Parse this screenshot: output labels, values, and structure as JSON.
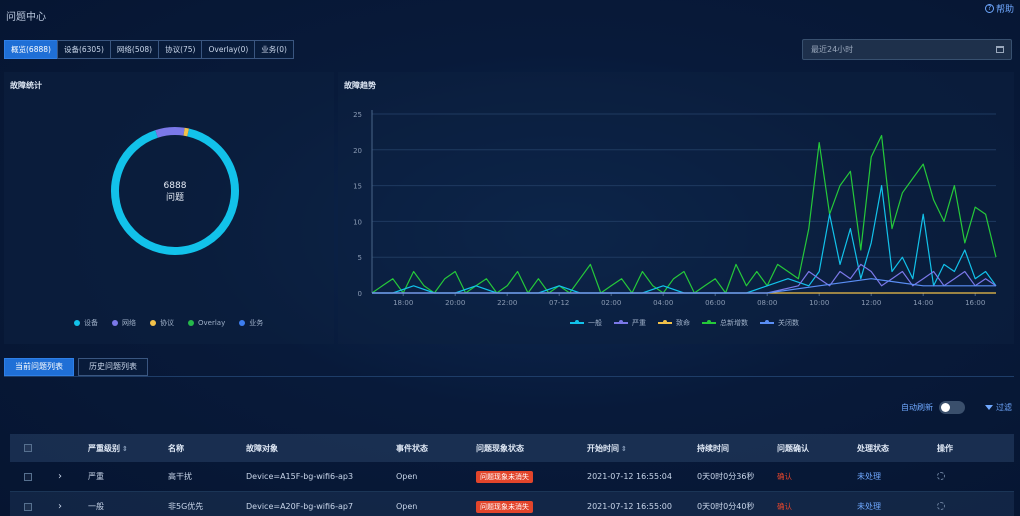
{
  "header": {
    "title": "问题中心",
    "help_label": "帮助",
    "help_icon": "?"
  },
  "tabs": [
    {
      "label": "概览(6888)",
      "active": true
    },
    {
      "label": "设备(6305)",
      "active": false
    },
    {
      "label": "网络(508)",
      "active": false
    },
    {
      "label": "协议(75)",
      "active": false
    },
    {
      "label": "Overlay(0)",
      "active": false
    },
    {
      "label": "业务(0)",
      "active": false
    }
  ],
  "time_range": {
    "value": "最近24小时",
    "icon": "calendar-icon"
  },
  "fault_stats": {
    "title": "故障统计",
    "total": "6888",
    "unit": "问题",
    "legend": [
      {
        "label": "设备",
        "color": "#12c2ea"
      },
      {
        "label": "网络",
        "color": "#7b78e8"
      },
      {
        "label": "协议",
        "color": "#f2c14a"
      },
      {
        "label": "Overlay",
        "color": "#25b94a"
      },
      {
        "label": "业务",
        "color": "#3d7ef0"
      }
    ]
  },
  "fault_trend": {
    "title": "故障趋势",
    "legend": [
      {
        "label": "一般",
        "color": "#12c2ea"
      },
      {
        "label": "严重",
        "color": "#7b78e8"
      },
      {
        "label": "致命",
        "color": "#f2c14a"
      },
      {
        "label": "总新增数",
        "color": "#25c93a"
      },
      {
        "label": "关闭数",
        "color": "#5a8ef5"
      }
    ]
  },
  "chart_data": [
    {
      "type": "pie",
      "title": "",
      "labels": [
        "设备",
        "网络",
        "协议",
        "Overlay",
        "业务"
      ],
      "values": [
        6305,
        508,
        75,
        0,
        0
      ],
      "center_label": "6888 问题"
    },
    {
      "type": "line",
      "title": "",
      "xlabel": "",
      "ylabel": "",
      "x_ticks": [
        "18:00",
        "20:00",
        "22:00",
        "07-12",
        "02:00",
        "04:00",
        "06:00",
        "08:00",
        "10:00",
        "12:00",
        "14:00",
        "16:00"
      ],
      "y_ticks": [
        0,
        5,
        10,
        15,
        20,
        25
      ],
      "ylim": [
        0,
        25
      ],
      "x_range_hours": [
        16.8,
        40.8
      ],
      "grid": true,
      "legend_position": "bottom",
      "series": [
        {
          "name": "总新增数",
          "color": "#25c93a",
          "x_hours": [
            16.8,
            17.2,
            17.6,
            18.0,
            18.4,
            18.8,
            19.2,
            19.6,
            20.0,
            20.4,
            20.8,
            21.2,
            21.6,
            22.0,
            22.4,
            22.8,
            23.2,
            23.6,
            24.0,
            24.4,
            24.8,
            25.2,
            25.6,
            26.0,
            26.4,
            26.8,
            27.2,
            27.6,
            28.0,
            28.4,
            28.8,
            29.2,
            29.6,
            30.0,
            30.4,
            30.8,
            31.2,
            31.6,
            32.0,
            32.4,
            32.8,
            33.2,
            33.6,
            34.0,
            34.4,
            34.8,
            35.2,
            35.6,
            36.0,
            36.4,
            36.8,
            37.2,
            37.6,
            38.0,
            38.4,
            38.8,
            39.2,
            39.6,
            40.0,
            40.4,
            40.8
          ],
          "values": [
            0,
            1,
            2,
            0,
            3,
            1,
            0,
            2,
            3,
            0,
            1,
            2,
            0,
            1,
            3,
            0,
            2,
            0,
            1,
            0,
            2,
            4,
            0,
            1,
            2,
            0,
            3,
            1,
            0,
            2,
            3,
            0,
            1,
            2,
            0,
            4,
            1,
            3,
            1,
            4,
            3,
            2,
            9,
            21,
            11,
            15,
            17,
            6,
            19,
            22,
            9,
            14,
            16,
            18,
            13,
            10,
            15,
            7,
            12,
            11,
            5
          ]
        },
        {
          "name": "一般",
          "color": "#12c2ea",
          "x_hours": [
            16.8,
            17.6,
            18.4,
            19.2,
            20.0,
            20.8,
            21.6,
            22.4,
            23.2,
            24.0,
            24.8,
            25.6,
            26.4,
            27.2,
            28.0,
            28.8,
            29.6,
            30.4,
            31.2,
            32.0,
            32.8,
            33.6,
            34.0,
            34.4,
            34.8,
            35.2,
            35.6,
            36.0,
            36.4,
            36.8,
            37.2,
            37.6,
            38.0,
            38.4,
            38.8,
            39.2,
            39.6,
            40.0,
            40.4,
            40.8
          ],
          "values": [
            0,
            0,
            1,
            0,
            0,
            1,
            0,
            0,
            0,
            1,
            0,
            0,
            0,
            0,
            1,
            0,
            0,
            0,
            0,
            1,
            2,
            1,
            3,
            11,
            4,
            9,
            2,
            7,
            15,
            3,
            5,
            2,
            11,
            1,
            4,
            3,
            6,
            2,
            3,
            1
          ]
        },
        {
          "name": "严重",
          "color": "#7b78e8",
          "x_hours": [
            16.8,
            18.0,
            20.0,
            22.0,
            24.0,
            26.0,
            28.0,
            30.0,
            32.0,
            33.2,
            33.6,
            34.0,
            34.4,
            34.8,
            35.2,
            35.6,
            36.0,
            36.4,
            36.8,
            37.2,
            37.6,
            38.0,
            38.4,
            38.8,
            39.2,
            39.6,
            40.0,
            40.4,
            40.8
          ],
          "values": [
            0,
            0,
            0,
            0,
            0,
            0,
            0,
            0,
            0,
            1,
            3,
            2,
            1,
            3,
            2,
            4,
            3,
            1,
            2,
            3,
            1,
            2,
            3,
            1,
            2,
            3,
            1,
            2,
            1
          ]
        },
        {
          "name": "致命",
          "color": "#f2c14a",
          "x_hours": [
            16.8,
            40.8
          ],
          "values": [
            0,
            0
          ]
        },
        {
          "name": "关闭数",
          "color": "#5a8ef5",
          "x_hours": [
            16.8,
            24.0,
            32.0,
            34.0,
            36.0,
            38.0,
            40.8
          ],
          "values": [
            0,
            0,
            0,
            1,
            2,
            1,
            1
          ]
        }
      ]
    }
  ],
  "list_tabs": [
    {
      "label": "当前问题列表",
      "active": true
    },
    {
      "label": "历史问题列表",
      "active": false
    }
  ],
  "toolbar": {
    "auto_refresh_label": "自动刷新",
    "auto_refresh_on": false,
    "filter_label": "过滤"
  },
  "table": {
    "columns": {
      "severity": "严重级别",
      "name": "名称",
      "object": "故障对象",
      "event_status": "事件状态",
      "phenomenon": "问题现象状态",
      "start_time": "开始时间",
      "duration": "持续时间",
      "confirm": "问题确认",
      "process": "处理状态",
      "action": "操作"
    },
    "rows": [
      {
        "severity": "严重",
        "name": "高干扰",
        "object": "Device=A15F-bg-wifi6-ap3",
        "event_status": "Open",
        "phenomenon": "问题现象未消失",
        "start_time": "2021-07-12 16:55:04",
        "duration": "0天0时0分36秒",
        "confirm": "确认",
        "process": "未处理"
      },
      {
        "severity": "一般",
        "name": "非5G优先",
        "object": "Device=A20F-bg-wifi6-ap7",
        "event_status": "Open",
        "phenomenon": "问题现象未消失",
        "start_time": "2021-07-12 16:55:00",
        "duration": "0天0时0分40秒",
        "confirm": "确认",
        "process": "未处理"
      }
    ]
  }
}
